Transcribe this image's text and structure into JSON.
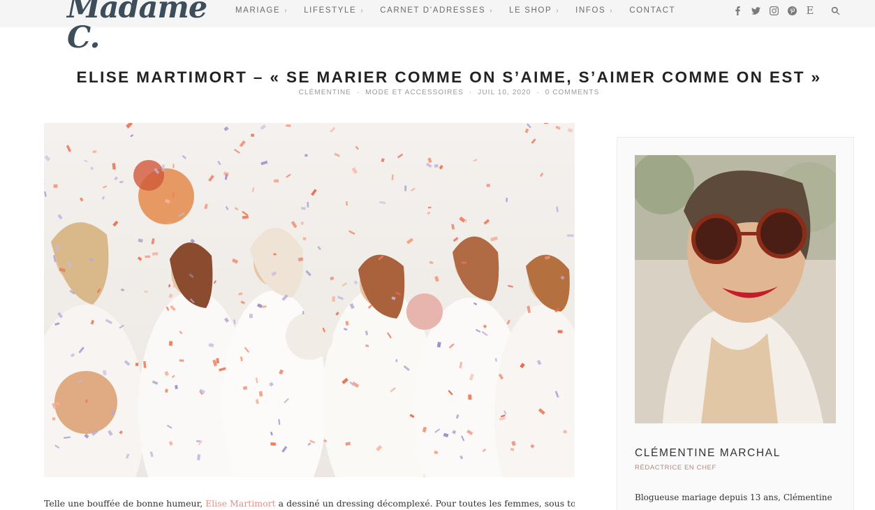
{
  "header": {
    "logo_text": "Madame C.",
    "nav": [
      {
        "label": "MARIAGE",
        "has_submenu": true
      },
      {
        "label": "LIFESTYLE",
        "has_submenu": true
      },
      {
        "label": "CARNET D’ADRESSES",
        "has_submenu": true
      },
      {
        "label": "LE SHOP",
        "has_submenu": true
      },
      {
        "label": "INFOS",
        "has_submenu": true
      },
      {
        "label": "CONTACT",
        "has_submenu": false
      }
    ],
    "chevron": "›",
    "social": [
      "facebook-icon",
      "twitter-icon",
      "instagram-icon",
      "pinterest-icon",
      "etsy-icon",
      "search-icon"
    ],
    "etsy_glyph": "E"
  },
  "post": {
    "title": "ELISE MARTIMORT – « SE MARIER COMME ON S’AIME, S’AIMER COMME ON EST »",
    "author": "CLÉMENTINE",
    "category": "MODE ET ACCESSOIRES",
    "date": "JUIL 10, 2020",
    "comments": "0 COMMENTS",
    "separator": "·",
    "intro_before": "Telle une bouffée de bonne humeur, ",
    "intro_link": "Elise Martimort",
    "intro_after": " a dessiné un dressing décomplexé. Pour toutes les femmes, sous toutes leurs"
  },
  "sidebar": {
    "author_name": "CLÉMENTINE MARCHAL",
    "author_role": "RÉDACTRICE EN CHEF",
    "bio": "Blogueuse mariage depuis 13 ans, Clémentine"
  },
  "colors": {
    "accent": "#e58f86",
    "logo": "#3d4e5a",
    "topbar": "#f5f5f5"
  }
}
